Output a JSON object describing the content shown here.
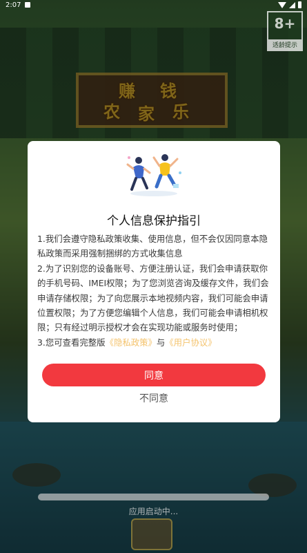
{
  "status_bar": {
    "time": "2:07"
  },
  "age_rating": {
    "number": "8+",
    "label": "适龄提示"
  },
  "background": {
    "title_line1": [
      "赚",
      "钱"
    ],
    "title_line2": [
      "农",
      "家",
      "乐"
    ]
  },
  "loading": {
    "text": "应用启动中..."
  },
  "dialog": {
    "title": "个人信息保护指引",
    "para1": "1.我们会遵守隐私政策收集、使用信息，但不会仅因同意本隐私政策而采用强制捆绑的方式收集信息",
    "para2": "2.为了识别您的设备账号、方便注册认证，我们会申请获取你的手机号码、IMEI权限；为了您浏览咨询及缓存文件，我们会申请存储权限；为了向您展示本地视频内容，我们可能会申请位置权限；为了方便您编辑个人信息，我们可能会申请相机权限；只有经过明示授权才会在实现功能或服务时使用；",
    "para3_prefix": "3.您可查看完整版",
    "privacy_link": "《隐私政策》",
    "para3_and": "与",
    "agreement_link": "《用户协议》",
    "agree_label": "同意",
    "disagree_label": "不同意"
  },
  "colors": {
    "primary_red": "#f2393f",
    "link_gold": "#f4c36d"
  }
}
